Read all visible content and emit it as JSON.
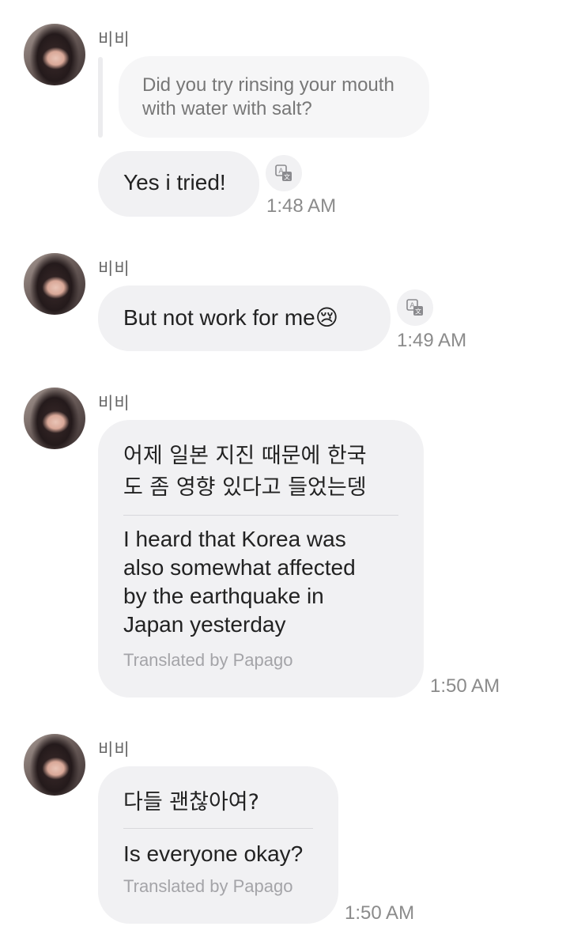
{
  "messages": [
    {
      "sender": "비비",
      "reply_quote": "Did you try rinsing your mouth with water with salt?",
      "text": "Yes i tried!",
      "time": "1:48 AM"
    },
    {
      "sender": "비비",
      "text": "But not work for me",
      "emoji": "😢",
      "time": "1:49 AM"
    },
    {
      "sender": "비비",
      "original_line1": "어제 일본 지진 때문에 한국",
      "original_line2": "도 좀 영향 있다고 들었는뎅",
      "translation_line1": "I heard that Korea was",
      "translation_line2": "also somewhat affected",
      "translation_line3": "by the earthquake in",
      "translation_line4": "Japan yesterday",
      "translated_by": "Translated by Papago",
      "time": "1:50 AM"
    },
    {
      "sender": "비비",
      "original_line1": "다들 괜찮아여?",
      "translation_line1": "Is everyone okay?",
      "translated_by": "Translated by Papago",
      "time": "1:50 AM"
    }
  ]
}
